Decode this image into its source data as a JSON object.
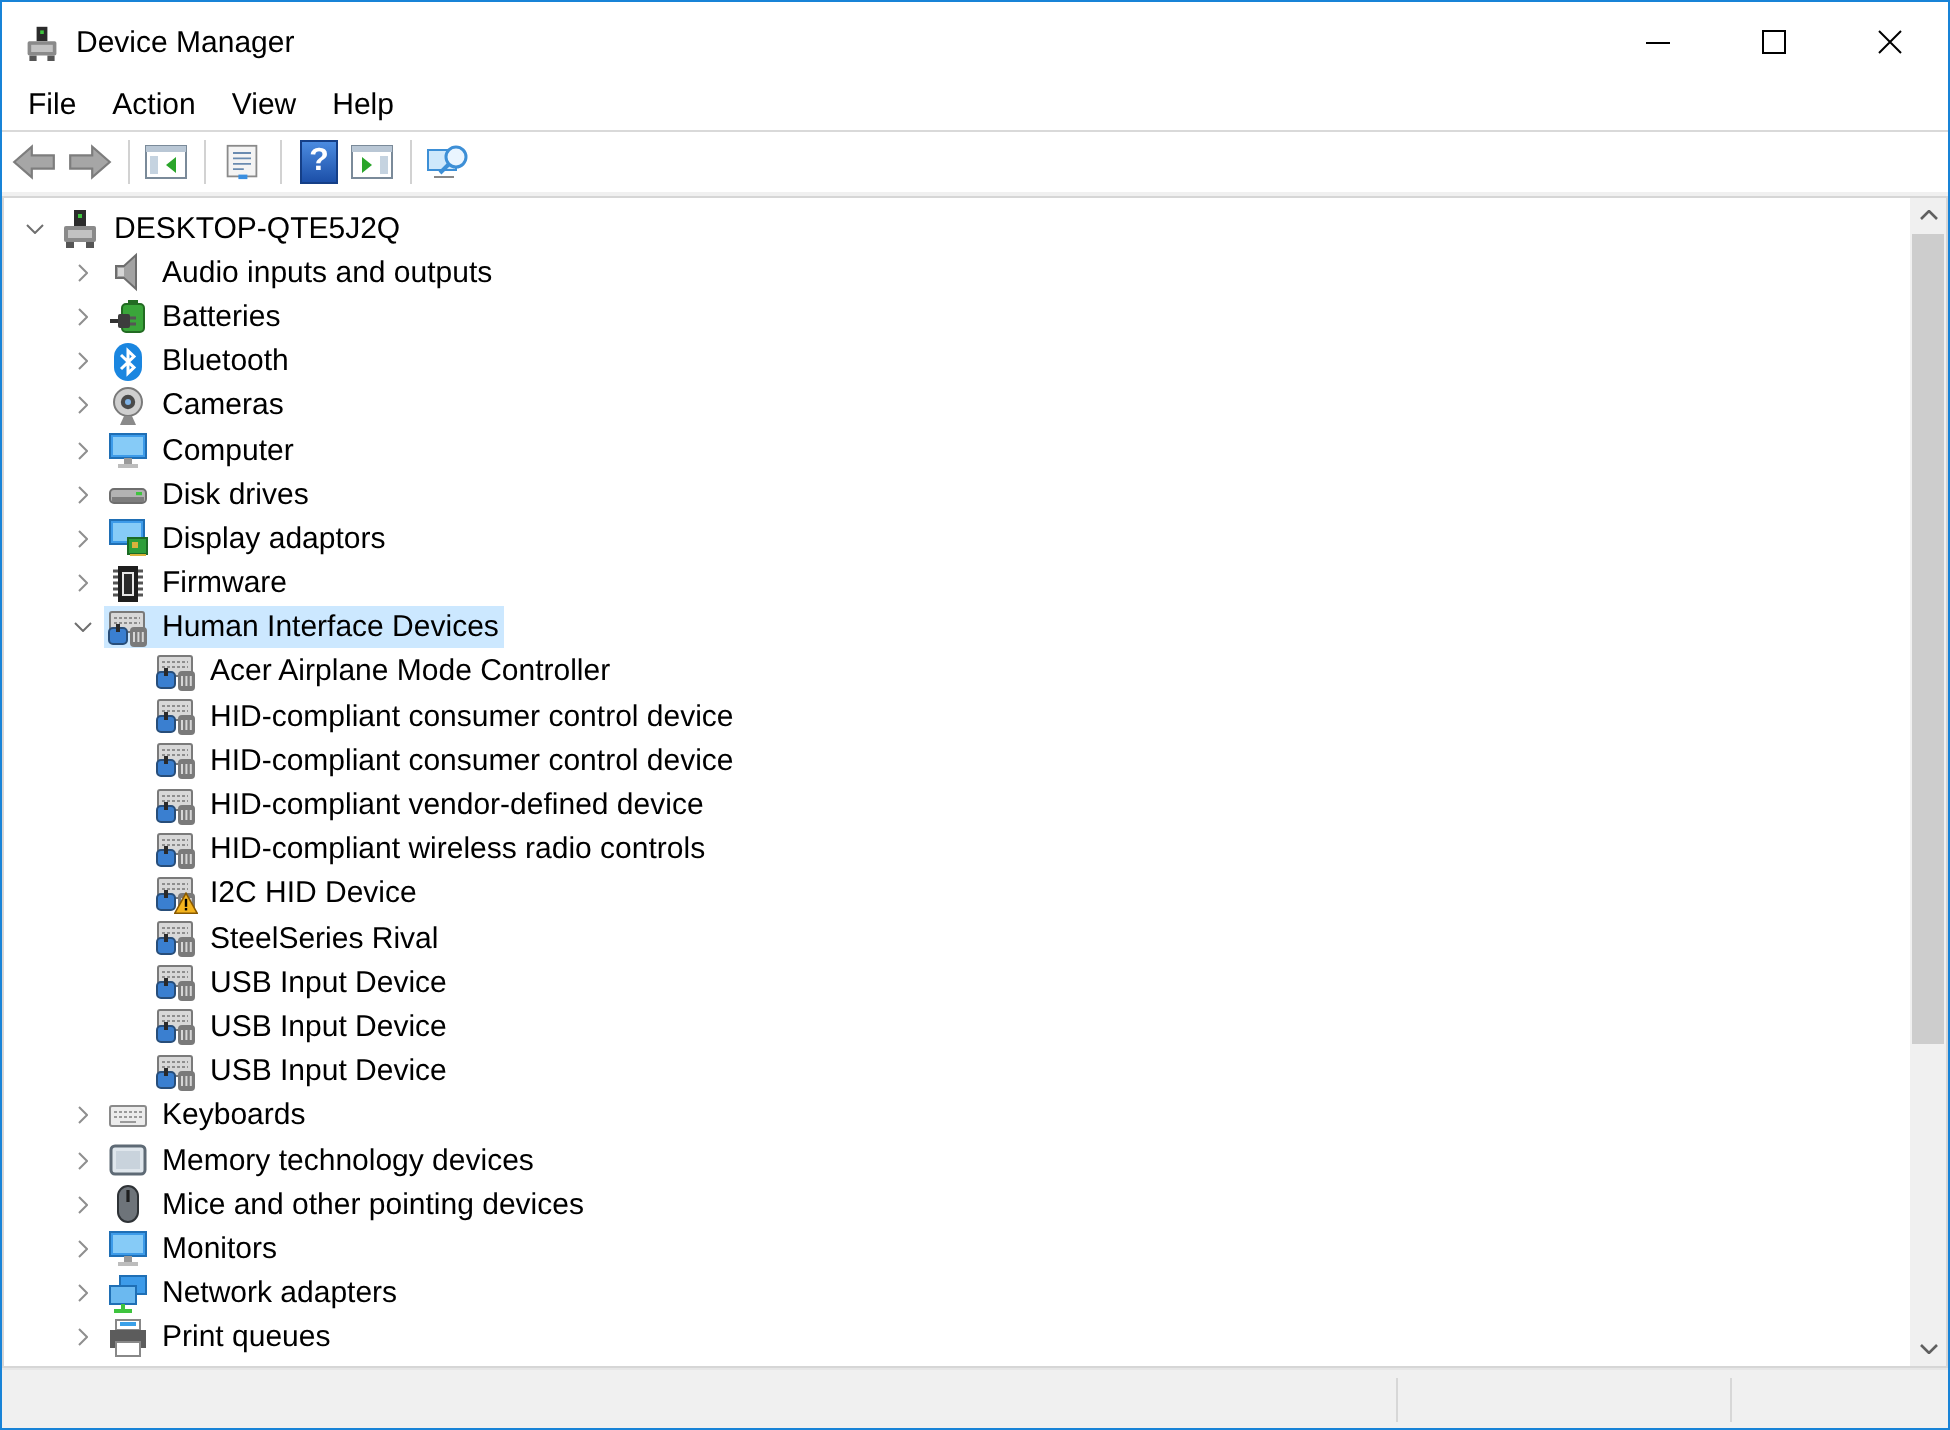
{
  "window": {
    "title": "Device Manager"
  },
  "menu": [
    {
      "label": "File"
    },
    {
      "label": "Action"
    },
    {
      "label": "View"
    },
    {
      "label": "Help"
    }
  ],
  "toolbar": {
    "groups": [
      {
        "buttons": [
          {
            "kind": "back",
            "disabled": true
          },
          {
            "kind": "forward",
            "disabled": true
          }
        ]
      },
      {
        "buttons": [
          {
            "kind": "console-tree",
            "disabled": false
          }
        ]
      },
      {
        "buttons": [
          {
            "kind": "properties",
            "disabled": false
          }
        ]
      },
      {
        "buttons": [
          {
            "kind": "help",
            "label": "?",
            "disabled": false
          },
          {
            "kind": "action-pane",
            "disabled": false
          }
        ]
      },
      {
        "buttons": [
          {
            "kind": "scan",
            "disabled": false
          }
        ]
      }
    ]
  },
  "tree": {
    "label": "DESKTOP-QTE5J2Q",
    "kind": "device",
    "expanded": true,
    "selected": false,
    "children": [
      {
        "label": "Audio inputs and outputs",
        "kind": "speaker",
        "expanded": false,
        "selected": false
      },
      {
        "label": "Batteries",
        "kind": "battery",
        "expanded": false,
        "selected": false
      },
      {
        "label": "Bluetooth",
        "kind": "bluetooth",
        "expanded": false,
        "selected": false
      },
      {
        "label": "Cameras",
        "kind": "webcam",
        "expanded": false,
        "selected": false
      },
      {
        "label": "Computer",
        "kind": "monitor",
        "expanded": false,
        "selected": false
      },
      {
        "label": "Disk drives",
        "kind": "disk",
        "expanded": false,
        "selected": false
      },
      {
        "label": "Display adaptors",
        "kind": "display-adapter",
        "expanded": false,
        "selected": false
      },
      {
        "label": "Firmware",
        "kind": "chip",
        "expanded": false,
        "selected": false
      },
      {
        "label": "Human Interface Devices",
        "kind": "hid",
        "expanded": true,
        "selected": true,
        "children": [
          {
            "label": "Acer Airplane Mode Controller",
            "kind": "hid",
            "warning": false,
            "selected": false
          },
          {
            "label": "HID-compliant consumer control device",
            "kind": "hid",
            "warning": false,
            "selected": false
          },
          {
            "label": "HID-compliant consumer control device",
            "kind": "hid",
            "warning": false,
            "selected": false
          },
          {
            "label": "HID-compliant vendor-defined device",
            "kind": "hid",
            "warning": false,
            "selected": false
          },
          {
            "label": "HID-compliant wireless radio controls",
            "kind": "hid",
            "warning": false,
            "selected": false
          },
          {
            "label": "I2C HID Device",
            "kind": "hid",
            "warning": true,
            "selected": false
          },
          {
            "label": "SteelSeries Rival",
            "kind": "hid",
            "warning": false,
            "selected": false
          },
          {
            "label": "USB Input Device",
            "kind": "hid",
            "warning": false,
            "selected": false
          },
          {
            "label": "USB Input Device",
            "kind": "hid",
            "warning": false,
            "selected": false
          },
          {
            "label": "USB Input Device",
            "kind": "hid",
            "warning": false,
            "selected": false
          }
        ]
      },
      {
        "label": "Keyboards",
        "kind": "keyboard",
        "expanded": false,
        "selected": false
      },
      {
        "label": "Memory technology devices",
        "kind": "memory",
        "expanded": false,
        "selected": false
      },
      {
        "label": "Mice and other pointing devices",
        "kind": "mouse",
        "expanded": false,
        "selected": false
      },
      {
        "label": "Monitors",
        "kind": "monitor",
        "expanded": false,
        "selected": false
      },
      {
        "label": "Network adapters",
        "kind": "network",
        "expanded": false,
        "selected": false
      },
      {
        "label": "Print queues",
        "kind": "printer",
        "expanded": false,
        "selected": false
      }
    ]
  }
}
